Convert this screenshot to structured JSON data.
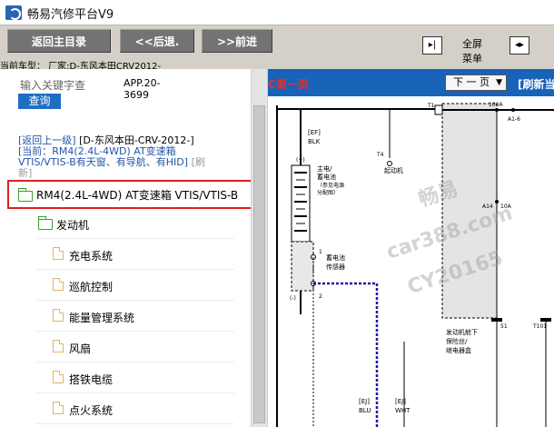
{
  "window": {
    "title": "畅易汽修平台V9"
  },
  "toolbar": {
    "home": "返回主目录",
    "back": "<<后退.",
    "forward": ">>前进",
    "fullscreen_line1": "全屏",
    "fullscreen_line2": "菜单",
    "fullscreen_icon": "fullscreen-icon",
    "split_icon": "split-icon"
  },
  "car": {
    "current": "当前车型：  厂家:D-东风本田CRV2012-"
  },
  "search": {
    "placeholder": "输入关键字查",
    "button": "查询"
  },
  "app_code": {
    "line1": "APP.20-",
    "line2": "3699"
  },
  "breadcrumb": {
    "up": "[返回上一级]",
    "path": "[D-东风本田-CRV-2012-]",
    "current1": "[当前：RM4(2.4L-4WD) AT变速箱",
    "current2": "VTIS/VTIS-B有天窗、有导航、有HID]",
    "refresh_a": "[刷",
    "refresh_b": "新]"
  },
  "tree": {
    "selected": "RM4(2.4L-4WD) AT变速箱 VTIS/VTIS-B",
    "engine": "发动机",
    "items": [
      "充电系统",
      "巡航控制",
      "能量管理系统",
      "风扇",
      "搭铁电缆",
      "点火系统"
    ]
  },
  "diagram_header": {
    "left": "C第一页",
    "next": "下 一 页",
    "refresh": "[刷新当"
  },
  "diagram": {
    "fuse_top": "[EF]",
    "fuse_code": "BLK",
    "label_a": "主电/",
    "label_b": "蓄电池",
    "label_c": "（参见电源",
    "label_d": "分配图）",
    "t4": "T4",
    "label_start": "起动机",
    "sensor_a": "蓄电池",
    "sensor_b": "传感器",
    "pin1": "1",
    "pin2": "2",
    "pin_plus": "(+)",
    "pin_minus": "(-)",
    "wire1": "[EJ]",
    "wire1_color": "BLU",
    "wire2": "[EJ]",
    "wire2_color": "WHT",
    "t1": "T1",
    "amp": "100A",
    "fuse_a1": "A1-6",
    "a14": "A14",
    "amp2": "10A",
    "ecu_a": "发动机舱下",
    "ecu_b": "保险丝/",
    "ecu_c": "继电器盒",
    "t51": "51",
    "t101": "T101",
    "watermark1": "畅易",
    "watermark2": "car388.com",
    "watermark3": "CY20165"
  }
}
